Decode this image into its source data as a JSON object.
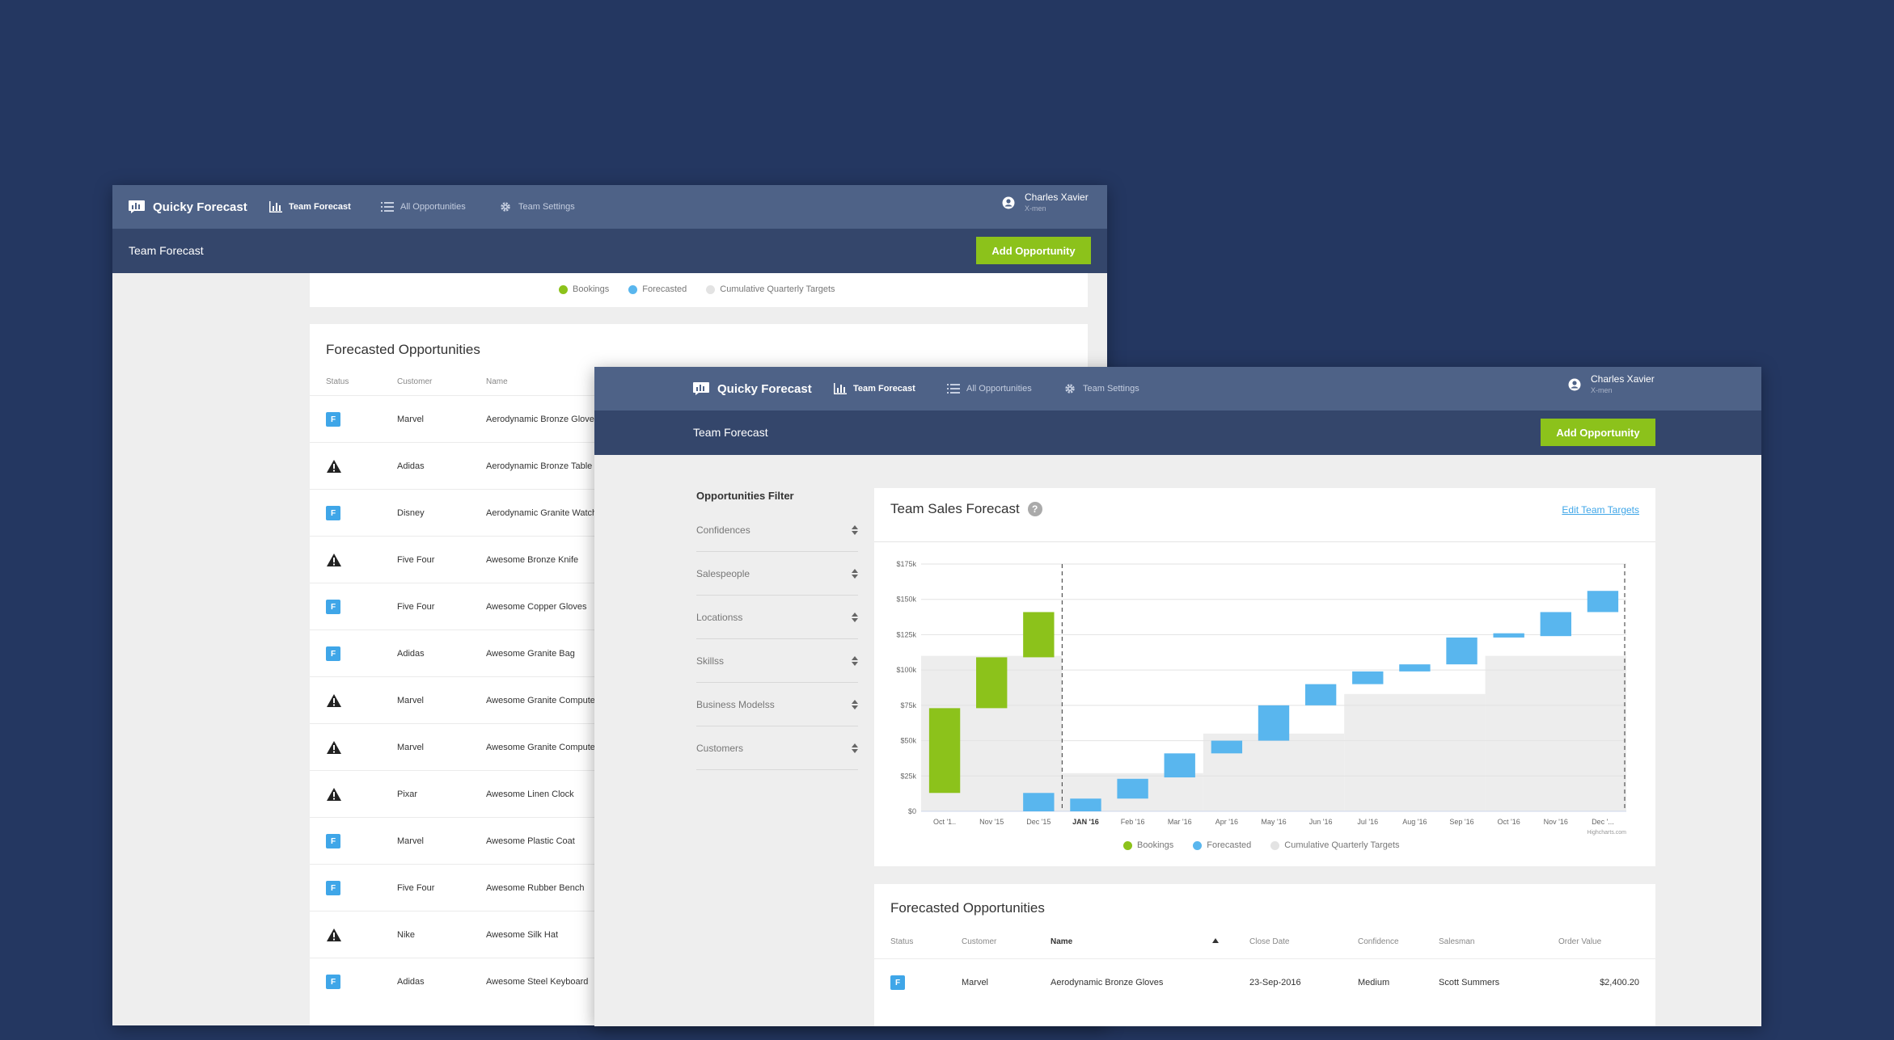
{
  "app": {
    "brand": "Quicky Forecast",
    "nav": [
      {
        "label": "Team Forecast",
        "active": true,
        "icon": "bar-chart-icon"
      },
      {
        "label": "All Opportunities",
        "active": false,
        "icon": "list-icon"
      },
      {
        "label": "Team Settings",
        "active": false,
        "icon": "gear-icon"
      }
    ],
    "user": {
      "name": "Charles Xavier",
      "org": "X-men",
      "icon": "user-circle-icon"
    },
    "page_title": "Team Forecast",
    "add_button": "Add Opportunity"
  },
  "colors": {
    "background": "#243761",
    "topbar": "#4e6287",
    "subbar": "#34466b",
    "accent_green": "#8cc21b",
    "forecast_blue": "#59b6ee",
    "target_gray": "#ededed"
  },
  "legend": [
    "Bookings",
    "Forecasted",
    "Cumulative Quarterly Targets"
  ],
  "filter": {
    "title": "Opportunities Filter",
    "items": [
      "Confidences",
      "Salespeople",
      "Locationss",
      "Skillss",
      "Business Modelss",
      "Customers"
    ]
  },
  "chart_card": {
    "title": "Team Sales Forecast",
    "help_icon": "question-icon",
    "edit_link": "Edit Team Targets",
    "credit": "Highcharts.com"
  },
  "chart_data": {
    "type": "waterfall",
    "y_tick_labels": [
      "$0",
      "$25k",
      "$50k",
      "$75k",
      "$100k",
      "$125k",
      "$150k",
      "$175k"
    ],
    "ylim": [
      0,
      175000
    ],
    "categories": [
      "Oct '1..",
      "Nov '15",
      "Dec '15",
      "JAN '16",
      "Feb '16",
      "Mar '16",
      "Apr '16",
      "May '16",
      "Jun '16",
      "Jul '16",
      "Aug '16",
      "Sep '16",
      "Oct '16",
      "Nov '16",
      "Dec '..."
    ],
    "bookings": [
      {
        "category": "Oct '1..",
        "from": 13000,
        "to": 73000
      },
      {
        "category": "Nov '15",
        "from": 73000,
        "to": 109000
      },
      {
        "category": "Dec '15",
        "from": 109000,
        "to": 141000
      }
    ],
    "forecasted": [
      {
        "category": "Dec '15",
        "from": 0,
        "to": 13000
      },
      {
        "category": "JAN '16",
        "from": 0,
        "to": 9000
      },
      {
        "category": "Feb '16",
        "from": 9000,
        "to": 23000
      },
      {
        "category": "Mar '16",
        "from": 24000,
        "to": 41000
      },
      {
        "category": "Apr '16",
        "from": 41000,
        "to": 50000
      },
      {
        "category": "May '16",
        "from": 50000,
        "to": 75000
      },
      {
        "category": "Jun '16",
        "from": 75000,
        "to": 90000
      },
      {
        "category": "Jul '16",
        "from": 90000,
        "to": 99000
      },
      {
        "category": "Aug '16",
        "from": 99000,
        "to": 104000
      },
      {
        "category": "Sep '16",
        "from": 104000,
        "to": 123000
      },
      {
        "category": "Oct '16",
        "from": 123000,
        "to": 126000
      },
      {
        "category": "Nov '16",
        "from": 124000,
        "to": 141000
      },
      {
        "category": "Dec '...",
        "from": 141000,
        "to": 156000
      }
    ],
    "quarterly_targets": [
      {
        "from_category": "Oct '1..",
        "to_category": "Dec '15",
        "value": 110000
      },
      {
        "from_category": "JAN '16",
        "to_category": "Mar '16",
        "value": 27000
      },
      {
        "from_category": "Apr '16",
        "to_category": "Jun '16",
        "value": 55000
      },
      {
        "from_category": "Jul '16",
        "to_category": "Sep '16",
        "value": 83000
      },
      {
        "from_category": "Oct '16",
        "to_category": "Dec '...",
        "value": 110000
      }
    ],
    "plot_lines_at": [
      "Oct '1..",
      "JAN '16",
      "Dec '..."
    ],
    "grid": true,
    "legend_position": "bottom-center"
  },
  "back_table": {
    "title": "Forecasted Opportunities",
    "columns": [
      "Status",
      "Customer",
      "Name"
    ],
    "rows": [
      {
        "status": "F",
        "customer": "Marvel",
        "name": "Aerodynamic Bronze Gloves"
      },
      {
        "status": "warning",
        "customer": "Adidas",
        "name": "Aerodynamic Bronze Table"
      },
      {
        "status": "F",
        "customer": "Disney",
        "name": "Aerodynamic Granite Watch"
      },
      {
        "status": "warning",
        "customer": "Five Four",
        "name": "Awesome Bronze Knife"
      },
      {
        "status": "F",
        "customer": "Five Four",
        "name": "Awesome Copper Gloves"
      },
      {
        "status": "F",
        "customer": "Adidas",
        "name": "Awesome Granite Bag"
      },
      {
        "status": "warning",
        "customer": "Marvel",
        "name": "Awesome Granite Computer"
      },
      {
        "status": "warning",
        "customer": "Marvel",
        "name": "Awesome Granite Computer"
      },
      {
        "status": "warning",
        "customer": "Pixar",
        "name": "Awesome Linen Clock"
      },
      {
        "status": "F",
        "customer": "Marvel",
        "name": "Awesome Plastic Coat"
      },
      {
        "status": "F",
        "customer": "Five Four",
        "name": "Awesome Rubber Bench"
      },
      {
        "status": "warning",
        "customer": "Nike",
        "name": "Awesome Silk Hat"
      },
      {
        "status": "F",
        "customer": "Adidas",
        "name": "Awesome Steel Keyboard"
      }
    ]
  },
  "front_table": {
    "title": "Forecasted Opportunities",
    "columns": [
      "Status",
      "Customer",
      "Name",
      "Close Date",
      "Confidence",
      "Salesman",
      "Order Value"
    ],
    "sort_icon": "sort-up-icon",
    "rows": [
      {
        "status": "F",
        "customer": "Marvel",
        "name": "Aerodynamic Bronze Gloves",
        "close_date": "23-Sep-2016",
        "confidence": "Medium",
        "salesman": "Scott Summers",
        "order_value": "$2,400.20"
      }
    ]
  }
}
